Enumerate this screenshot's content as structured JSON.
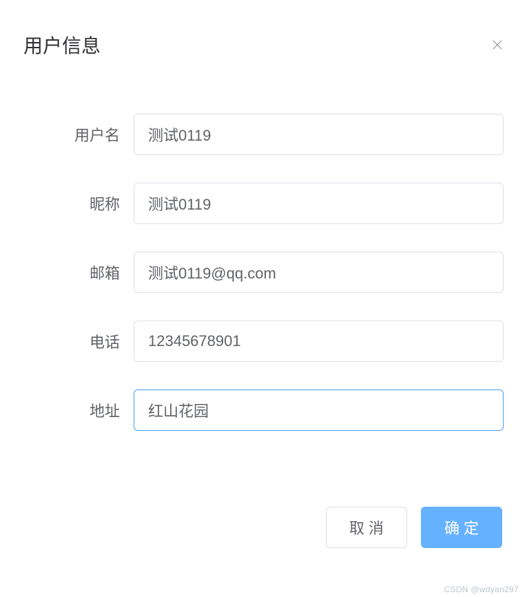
{
  "dialog": {
    "title": "用户信息"
  },
  "form": {
    "username": {
      "label": "用户名",
      "value": "测试0119"
    },
    "nickname": {
      "label": "昵称",
      "value": "测试0119"
    },
    "email": {
      "label": "邮箱",
      "value": "测试0119@qq.com"
    },
    "phone": {
      "label": "电话",
      "value": "12345678901"
    },
    "address": {
      "label": "地址",
      "value": "红山花园"
    }
  },
  "footer": {
    "cancel_label": "取消",
    "confirm_label": "确定"
  },
  "watermark": "CSDN @wdyan297"
}
